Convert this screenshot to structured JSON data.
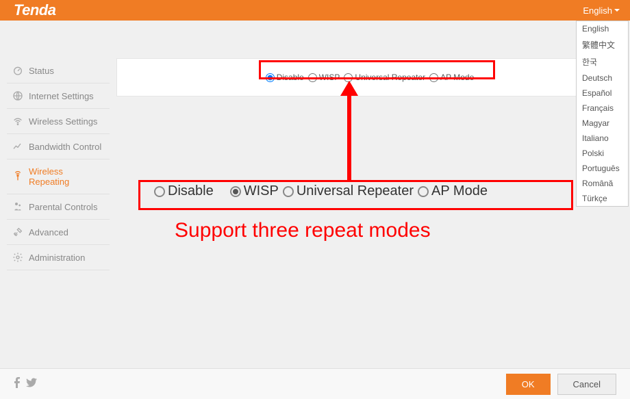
{
  "header": {
    "logo": "Tenda",
    "language_current": "English"
  },
  "languages": [
    "English",
    "繁體中文",
    "한국",
    "Deutsch",
    "Español",
    "Français",
    "Magyar",
    "Italiano",
    "Polski",
    "Português",
    "Română",
    "Türkçe"
  ],
  "sidebar": {
    "items": [
      {
        "label": "Status"
      },
      {
        "label": "Internet Settings"
      },
      {
        "label": "Wireless Settings"
      },
      {
        "label": "Bandwidth Control"
      },
      {
        "label": "Wireless Repeating"
      },
      {
        "label": "Parental Controls"
      },
      {
        "label": "Advanced"
      },
      {
        "label": "Administration"
      }
    ],
    "active_index": 4
  },
  "modes": {
    "options": [
      "Disable",
      "WISP",
      "Universal Repeater",
      "AP Mode"
    ],
    "selected_small": "Disable",
    "selected_large": "WISP"
  },
  "annotation": {
    "caption": "Support three repeat modes"
  },
  "footer": {
    "ok": "OK",
    "cancel": "Cancel"
  }
}
